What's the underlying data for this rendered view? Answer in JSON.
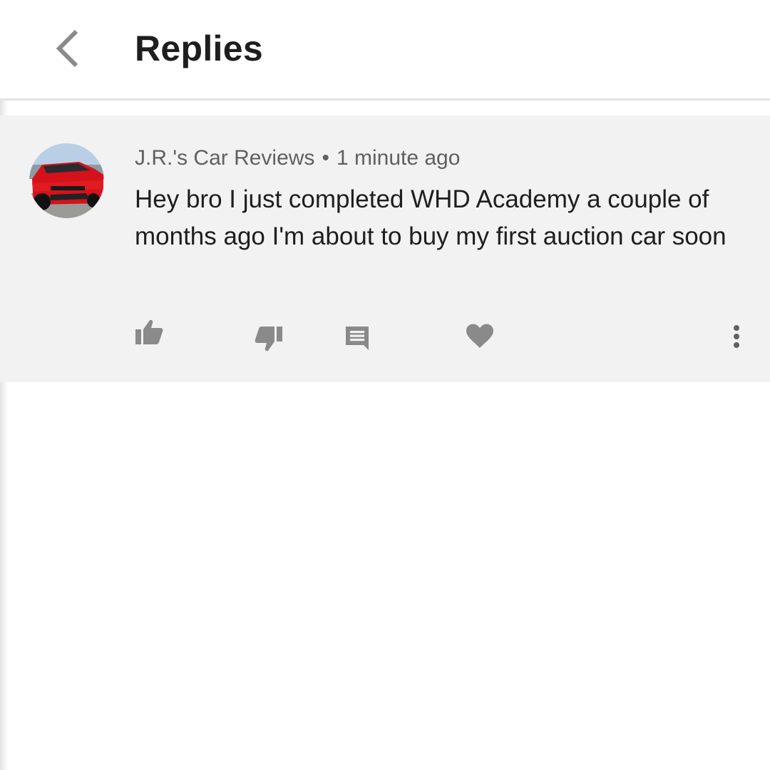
{
  "header": {
    "title": "Replies",
    "back_icon": "chevron-left-icon"
  },
  "comment": {
    "author": "J.R.'s Car Reviews",
    "separator": "•",
    "time": "1 minute ago",
    "text": "Hey bro I just completed WHD Academy a couple of months ago I'm about to buy my first auction car soon",
    "avatar": "red-car-avatar",
    "actions": [
      {
        "icon": "thumbs-up-icon"
      },
      {
        "icon": "thumbs-down-icon"
      },
      {
        "icon": "reply-comment-icon"
      },
      {
        "icon": "heart-icon"
      },
      {
        "icon": "more-vert-icon"
      }
    ]
  },
  "colors": {
    "background": "#ffffff",
    "comment_background": "#f2f2f2",
    "icon": "#8a8a8a",
    "text_primary": "#1e1e1e",
    "text_secondary": "#606060"
  }
}
